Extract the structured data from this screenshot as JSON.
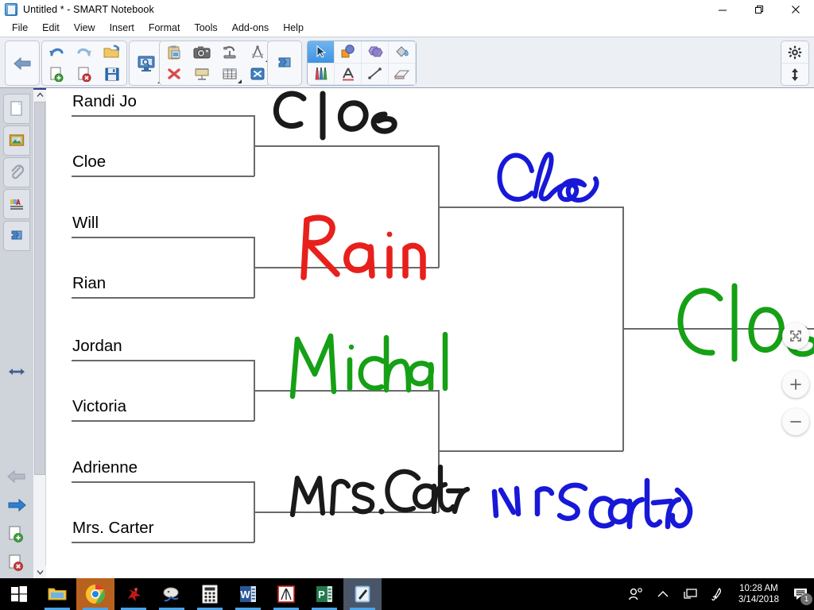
{
  "window": {
    "title": "Untitled * - SMART Notebook",
    "app_icon": "smart-notebook-icon",
    "controls": {
      "minimize": "minimize-icon",
      "restore": "restore-icon",
      "close": "close-icon"
    }
  },
  "menubar": {
    "items": [
      {
        "label": "File"
      },
      {
        "label": "Edit"
      },
      {
        "label": "View"
      },
      {
        "label": "Insert"
      },
      {
        "label": "Format"
      },
      {
        "label": "Tools"
      },
      {
        "label": "Add-ons"
      },
      {
        "label": "Help"
      }
    ]
  },
  "toolbar": {
    "groups": [
      {
        "name": "navigation",
        "buttons": [
          {
            "icon": "back-arrow-icon",
            "label": "Previous Page"
          }
        ]
      },
      {
        "name": "file-actions",
        "buttons": [
          {
            "icon": "undo-icon",
            "label": "Undo"
          },
          {
            "icon": "redo-icon",
            "label": "Redo"
          },
          {
            "icon": "open-folder-icon",
            "label": "Open File"
          },
          {
            "icon": "add-page-icon",
            "label": "Add Page"
          },
          {
            "icon": "delete-page-icon",
            "label": "Delete Page"
          },
          {
            "icon": "save-icon",
            "label": "Save"
          }
        ]
      },
      {
        "name": "screen-capture",
        "buttons": [
          {
            "icon": "screen-capture-icon",
            "label": "Screen Capture"
          }
        ]
      },
      {
        "name": "insert-objects",
        "buttons": [
          {
            "icon": "paste-icon",
            "label": "Paste"
          },
          {
            "icon": "camera-icon",
            "label": "Insert Picture"
          },
          {
            "icon": "document-camera-icon",
            "label": "Document Camera"
          },
          {
            "icon": "measurement-tools-icon",
            "label": "Measurement Tools"
          },
          {
            "icon": "delete-x-icon",
            "label": "Delete"
          },
          {
            "icon": "screen-shade-icon",
            "label": "Screen Shade"
          },
          {
            "icon": "table-icon",
            "label": "Insert Table"
          },
          {
            "icon": "full-screen-icon",
            "label": "Full Screen"
          }
        ]
      },
      {
        "name": "add-ons",
        "buttons": [
          {
            "icon": "puzzle-piece-icon",
            "label": "Add-ons"
          }
        ]
      }
    ],
    "tool_palette": [
      {
        "icon": "select-arrow-icon",
        "label": "Select",
        "active": true
      },
      {
        "icon": "shapes-icon",
        "label": "Shapes",
        "active": false
      },
      {
        "icon": "regular-polygons-icon",
        "label": "Regular Polygons",
        "active": false
      },
      {
        "icon": "fill-bucket-icon",
        "label": "Fill",
        "active": false
      },
      {
        "icon": "pens-icon",
        "label": "Pens",
        "active": false
      },
      {
        "icon": "text-icon",
        "label": "Text",
        "active": false
      },
      {
        "icon": "line-icon",
        "label": "Lines",
        "active": false
      },
      {
        "icon": "eraser-icon",
        "label": "Eraser",
        "active": false
      }
    ],
    "right_buttons": [
      {
        "icon": "gear-icon",
        "label": "Settings"
      },
      {
        "icon": "move-toolbar-icon",
        "label": "Move Toolbar"
      }
    ]
  },
  "sidebar": {
    "tabs": [
      {
        "icon": "page-sorter-icon",
        "label": "Page Sorter"
      },
      {
        "icon": "gallery-icon",
        "label": "Gallery"
      },
      {
        "icon": "attachments-icon",
        "label": "Attachments"
      },
      {
        "icon": "properties-icon",
        "label": "Properties"
      },
      {
        "icon": "addons-puzzle-icon",
        "label": "Add-ons"
      }
    ],
    "resize_handle": {
      "icon": "horizontal-resize-icon",
      "label": "Resize Sidebar"
    },
    "bottom_buttons": [
      {
        "icon": "previous-page-arrow-icon",
        "label": "Previous Page",
        "disabled": true
      },
      {
        "icon": "next-page-arrow-icon",
        "label": "Next Page",
        "disabled": false
      },
      {
        "icon": "add-page-icon",
        "label": "Add Page",
        "disabled": false
      },
      {
        "icon": "delete-page-icon",
        "label": "Delete Page",
        "disabled": false
      }
    ]
  },
  "canvas": {
    "zoom_controls": [
      {
        "icon": "fit-to-screen-icon",
        "label": "Fit to Screen"
      },
      {
        "icon": "zoom-in-icon",
        "label": "Zoom In"
      },
      {
        "icon": "zoom-out-icon",
        "label": "Zoom Out"
      }
    ],
    "bracket": {
      "title": "tournament-bracket",
      "round1_seeds": [
        {
          "name": "Randi Jo"
        },
        {
          "name": "Cloe"
        },
        {
          "name": "Will"
        },
        {
          "name": "Rian"
        },
        {
          "name": "Jordan"
        },
        {
          "name": "Victoria"
        },
        {
          "name": "Adrienne"
        },
        {
          "name": "Mrs. Carter"
        }
      ],
      "annotations": [
        {
          "text": "Cloe",
          "color": "#1a1a1a",
          "round": "quarterfinal-1",
          "style": "print"
        },
        {
          "text": "Rain",
          "color": "#e8201c",
          "round": "quarterfinal-2",
          "style": "print"
        },
        {
          "text": "Micheal",
          "color": "#15a015",
          "round": "quarterfinal-3",
          "style": "print"
        },
        {
          "text": "Mrs.Carter",
          "color": "#1a1a1a",
          "round": "quarterfinal-4",
          "style": "print"
        },
        {
          "text": "Cloe",
          "color": "#1818d8",
          "round": "semifinal-1",
          "style": "cursive"
        },
        {
          "text": "mrs carter",
          "color": "#1818d8",
          "round": "semifinal-2",
          "style": "print"
        },
        {
          "text": "Cloe",
          "color": "#15a015",
          "round": "champion",
          "style": "print"
        }
      ]
    }
  },
  "taskbar": {
    "items": [
      {
        "icon": "windows-start-icon",
        "label": "Start",
        "active": false
      },
      {
        "icon": "file-explorer-icon",
        "label": "File Explorer",
        "active": false,
        "running": true
      },
      {
        "icon": "chrome-icon",
        "label": "Google Chrome",
        "active": true,
        "running": true
      },
      {
        "icon": "red-app-icon",
        "label": "Red Application",
        "active": false,
        "running": true
      },
      {
        "icon": "mouse-app-icon",
        "label": "Mouse Application",
        "active": false,
        "running": true
      },
      {
        "icon": "calculator-icon",
        "label": "Calculator",
        "active": false,
        "running": true
      },
      {
        "icon": "word-icon",
        "label": "Microsoft Word",
        "active": false,
        "running": true
      },
      {
        "icon": "acrobat-icon",
        "label": "Adobe Acrobat",
        "active": false,
        "running": true
      },
      {
        "icon": "powerpoint-icon",
        "label": "Microsoft PowerPoint",
        "active": false,
        "running": true
      },
      {
        "icon": "smart-notebook-icon",
        "label": "SMART Notebook",
        "active": true,
        "running": true
      }
    ],
    "tray": [
      {
        "icon": "people-icon",
        "label": "People"
      },
      {
        "icon": "chevron-up-icon",
        "label": "Show hidden icons"
      },
      {
        "icon": "display-icon",
        "label": "Display Settings"
      },
      {
        "icon": "pen-icon",
        "label": "Pen Input"
      }
    ],
    "clock": {
      "time": "10:28 AM",
      "date": "3/14/2018"
    },
    "notifications": {
      "icon": "notifications-icon",
      "count": "1"
    }
  }
}
